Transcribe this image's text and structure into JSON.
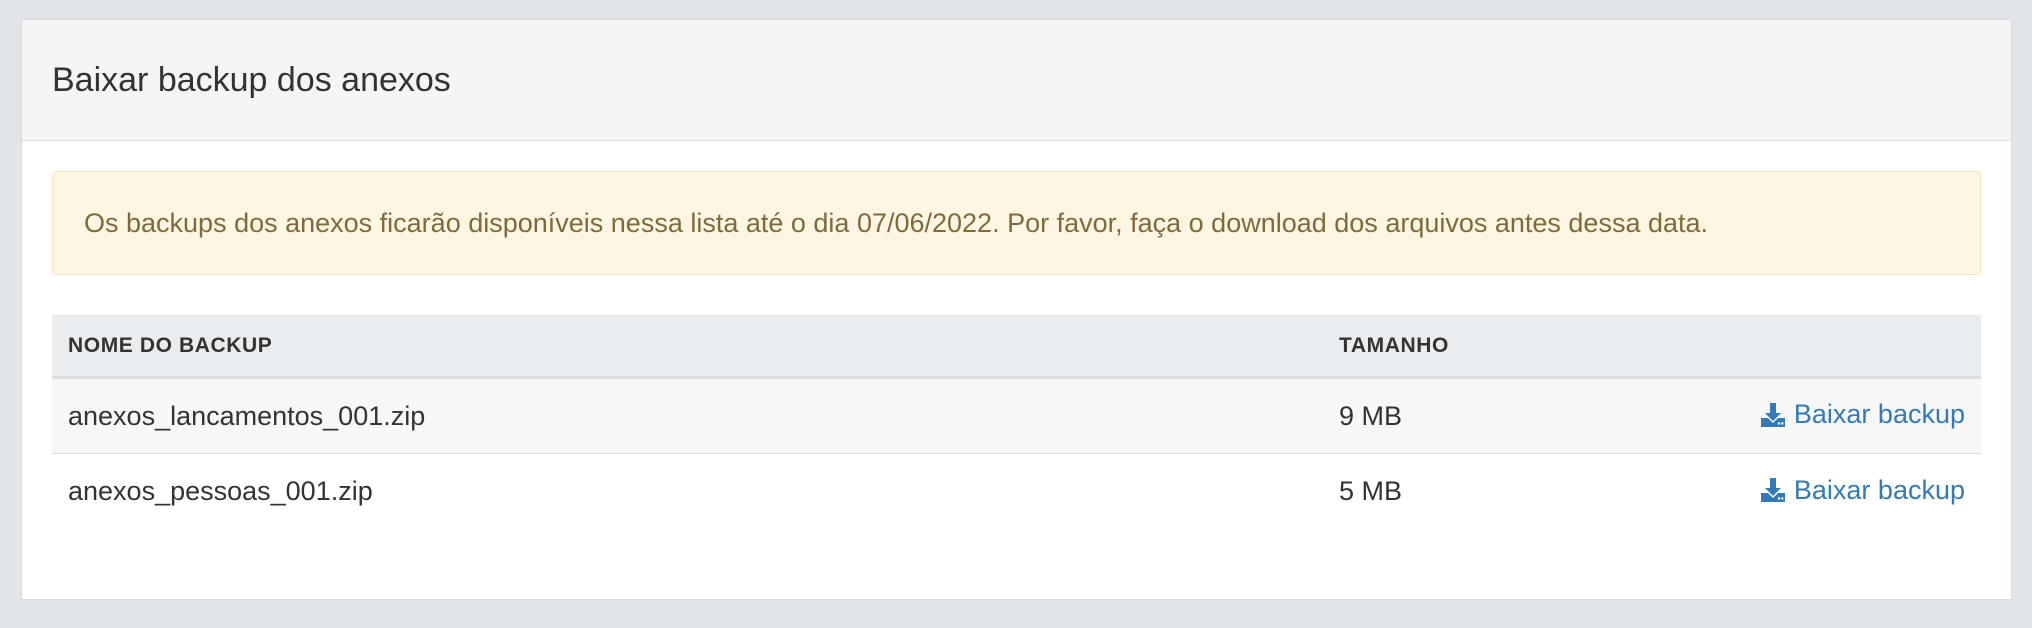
{
  "panel": {
    "title": "Baixar backup dos anexos"
  },
  "alert": {
    "text": "Os backups dos anexos ficarão disponíveis nessa lista até o dia 07/06/2022. Por favor, faça o download dos arquivos antes dessa data."
  },
  "table": {
    "headers": {
      "name": "NOME DO BACKUP",
      "size": "TAMANHO"
    },
    "rows": [
      {
        "name": "anexos_lancamentos_001.zip",
        "size": "9 MB",
        "action": "Baixar backup"
      },
      {
        "name": "anexos_pessoas_001.zip",
        "size": "5 MB",
        "action": "Baixar backup"
      }
    ]
  },
  "colors": {
    "link": "#337ab7",
    "alert_bg": "#fcf6e3",
    "alert_text": "#7f6a3c",
    "header_bg": "#e9edf0"
  },
  "icons": {
    "download": "download-icon"
  }
}
